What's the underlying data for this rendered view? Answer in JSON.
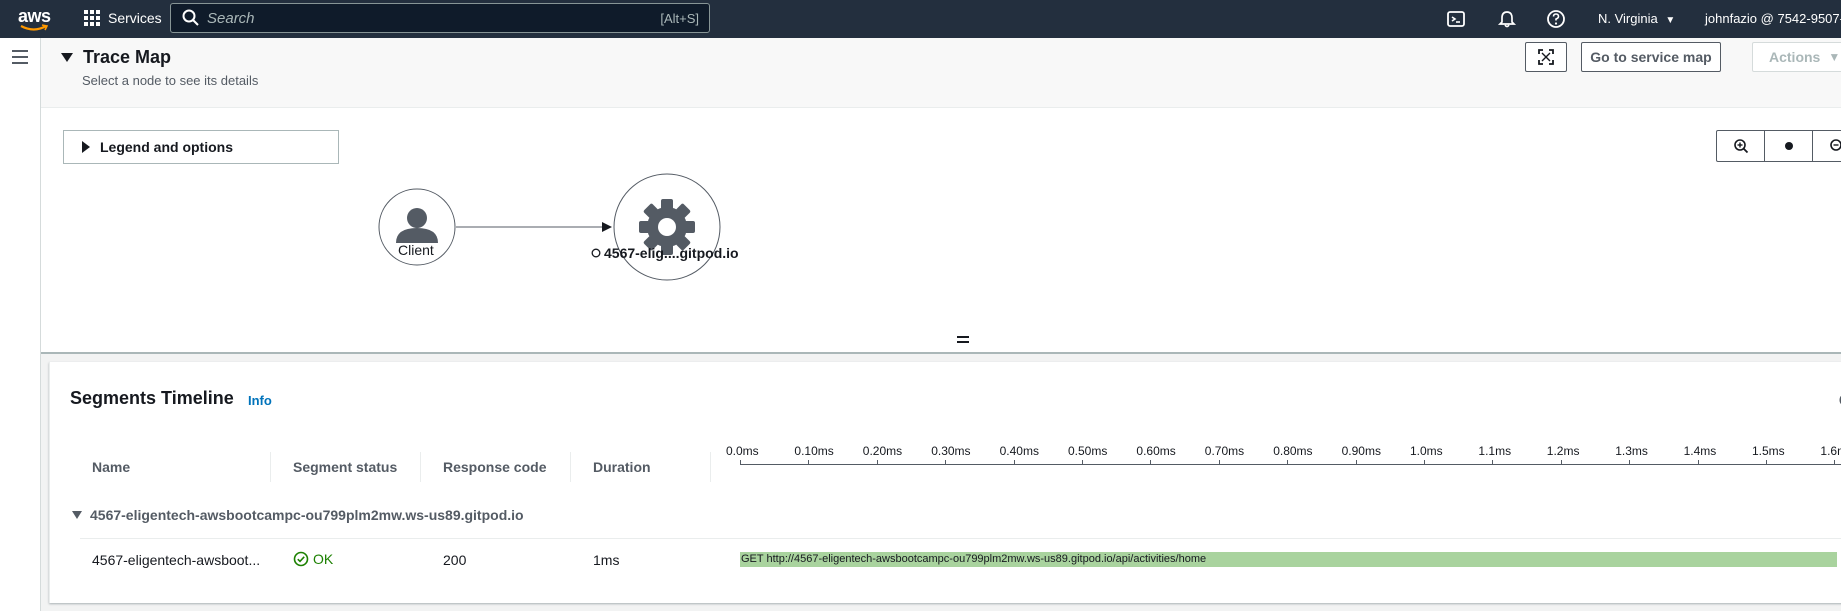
{
  "nav": {
    "logo_text": "aws",
    "services_label": "Services",
    "search_placeholder": "Search",
    "search_shortcut": "[Alt+S]",
    "region": "N. Virginia",
    "account": "johnfazio @ 7542-9507-"
  },
  "trace_map": {
    "title": "Trace Map",
    "subtitle": "Select a node to see its details",
    "go_to_service_map": "Go to service map",
    "actions_label": "Actions",
    "legend_label": "Legend and options",
    "nodes": {
      "client_label": "Client",
      "service_label": "4567-elig....gitpod.io"
    }
  },
  "timeline": {
    "title": "Segments Timeline",
    "info_link": "Info",
    "columns": {
      "name": "Name",
      "segment_status": "Segment status",
      "response_code": "Response code",
      "duration": "Duration"
    },
    "ticks": [
      "0.0ms",
      "0.10ms",
      "0.20ms",
      "0.30ms",
      "0.40ms",
      "0.50ms",
      "0.60ms",
      "0.70ms",
      "0.80ms",
      "0.90ms",
      "1.0ms",
      "1.1ms",
      "1.2ms",
      "1.3ms",
      "1.4ms",
      "1.5ms",
      "1.6m"
    ],
    "group_name": "4567-eligentech-awsbootcampc-ou799plm2mw.ws-us89.gitpod.io",
    "row": {
      "name": "4567-eligentech-awsboot...",
      "status": "OK",
      "response_code": "200",
      "duration": "1ms",
      "bar_label": "GET http://4567-eligentech-awsbootcampc-ou799plm2mw.ws-us89.gitpod.io/api/activities/home"
    }
  },
  "colors": {
    "nav_bg": "#232f3e",
    "link": "#0073bb",
    "ok_green": "#1d8102",
    "bar_green": "#a9d39e"
  }
}
